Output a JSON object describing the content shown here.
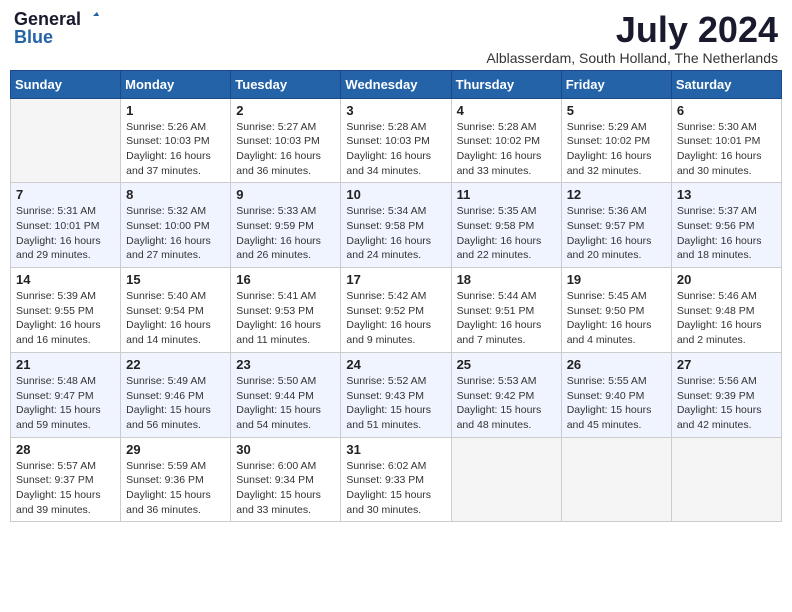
{
  "header": {
    "logo_general": "General",
    "logo_blue": "Blue",
    "month": "July 2024",
    "location": "Alblasserdam, South Holland, The Netherlands"
  },
  "weekdays": [
    "Sunday",
    "Monday",
    "Tuesday",
    "Wednesday",
    "Thursday",
    "Friday",
    "Saturday"
  ],
  "weeks": [
    [
      {
        "day": "",
        "info": ""
      },
      {
        "day": "1",
        "info": "Sunrise: 5:26 AM\nSunset: 10:03 PM\nDaylight: 16 hours\nand 37 minutes."
      },
      {
        "day": "2",
        "info": "Sunrise: 5:27 AM\nSunset: 10:03 PM\nDaylight: 16 hours\nand 36 minutes."
      },
      {
        "day": "3",
        "info": "Sunrise: 5:28 AM\nSunset: 10:03 PM\nDaylight: 16 hours\nand 34 minutes."
      },
      {
        "day": "4",
        "info": "Sunrise: 5:28 AM\nSunset: 10:02 PM\nDaylight: 16 hours\nand 33 minutes."
      },
      {
        "day": "5",
        "info": "Sunrise: 5:29 AM\nSunset: 10:02 PM\nDaylight: 16 hours\nand 32 minutes."
      },
      {
        "day": "6",
        "info": "Sunrise: 5:30 AM\nSunset: 10:01 PM\nDaylight: 16 hours\nand 30 minutes."
      }
    ],
    [
      {
        "day": "7",
        "info": "Sunrise: 5:31 AM\nSunset: 10:01 PM\nDaylight: 16 hours\nand 29 minutes."
      },
      {
        "day": "8",
        "info": "Sunrise: 5:32 AM\nSunset: 10:00 PM\nDaylight: 16 hours\nand 27 minutes."
      },
      {
        "day": "9",
        "info": "Sunrise: 5:33 AM\nSunset: 9:59 PM\nDaylight: 16 hours\nand 26 minutes."
      },
      {
        "day": "10",
        "info": "Sunrise: 5:34 AM\nSunset: 9:58 PM\nDaylight: 16 hours\nand 24 minutes."
      },
      {
        "day": "11",
        "info": "Sunrise: 5:35 AM\nSunset: 9:58 PM\nDaylight: 16 hours\nand 22 minutes."
      },
      {
        "day": "12",
        "info": "Sunrise: 5:36 AM\nSunset: 9:57 PM\nDaylight: 16 hours\nand 20 minutes."
      },
      {
        "day": "13",
        "info": "Sunrise: 5:37 AM\nSunset: 9:56 PM\nDaylight: 16 hours\nand 18 minutes."
      }
    ],
    [
      {
        "day": "14",
        "info": "Sunrise: 5:39 AM\nSunset: 9:55 PM\nDaylight: 16 hours\nand 16 minutes."
      },
      {
        "day": "15",
        "info": "Sunrise: 5:40 AM\nSunset: 9:54 PM\nDaylight: 16 hours\nand 14 minutes."
      },
      {
        "day": "16",
        "info": "Sunrise: 5:41 AM\nSunset: 9:53 PM\nDaylight: 16 hours\nand 11 minutes."
      },
      {
        "day": "17",
        "info": "Sunrise: 5:42 AM\nSunset: 9:52 PM\nDaylight: 16 hours\nand 9 minutes."
      },
      {
        "day": "18",
        "info": "Sunrise: 5:44 AM\nSunset: 9:51 PM\nDaylight: 16 hours\nand 7 minutes."
      },
      {
        "day": "19",
        "info": "Sunrise: 5:45 AM\nSunset: 9:50 PM\nDaylight: 16 hours\nand 4 minutes."
      },
      {
        "day": "20",
        "info": "Sunrise: 5:46 AM\nSunset: 9:48 PM\nDaylight: 16 hours\nand 2 minutes."
      }
    ],
    [
      {
        "day": "21",
        "info": "Sunrise: 5:48 AM\nSunset: 9:47 PM\nDaylight: 15 hours\nand 59 minutes."
      },
      {
        "day": "22",
        "info": "Sunrise: 5:49 AM\nSunset: 9:46 PM\nDaylight: 15 hours\nand 56 minutes."
      },
      {
        "day": "23",
        "info": "Sunrise: 5:50 AM\nSunset: 9:44 PM\nDaylight: 15 hours\nand 54 minutes."
      },
      {
        "day": "24",
        "info": "Sunrise: 5:52 AM\nSunset: 9:43 PM\nDaylight: 15 hours\nand 51 minutes."
      },
      {
        "day": "25",
        "info": "Sunrise: 5:53 AM\nSunset: 9:42 PM\nDaylight: 15 hours\nand 48 minutes."
      },
      {
        "day": "26",
        "info": "Sunrise: 5:55 AM\nSunset: 9:40 PM\nDaylight: 15 hours\nand 45 minutes."
      },
      {
        "day": "27",
        "info": "Sunrise: 5:56 AM\nSunset: 9:39 PM\nDaylight: 15 hours\nand 42 minutes."
      }
    ],
    [
      {
        "day": "28",
        "info": "Sunrise: 5:57 AM\nSunset: 9:37 PM\nDaylight: 15 hours\nand 39 minutes."
      },
      {
        "day": "29",
        "info": "Sunrise: 5:59 AM\nSunset: 9:36 PM\nDaylight: 15 hours\nand 36 minutes."
      },
      {
        "day": "30",
        "info": "Sunrise: 6:00 AM\nSunset: 9:34 PM\nDaylight: 15 hours\nand 33 minutes."
      },
      {
        "day": "31",
        "info": "Sunrise: 6:02 AM\nSunset: 9:33 PM\nDaylight: 15 hours\nand 30 minutes."
      },
      {
        "day": "",
        "info": ""
      },
      {
        "day": "",
        "info": ""
      },
      {
        "day": "",
        "info": ""
      }
    ]
  ]
}
